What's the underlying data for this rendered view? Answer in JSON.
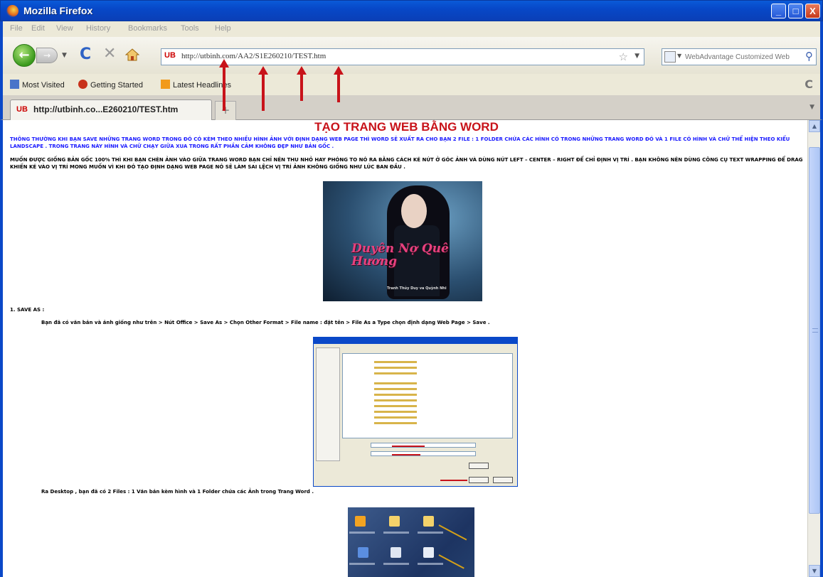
{
  "window": {
    "title": "Mozilla Firefox",
    "buttons": {
      "minimize": "_",
      "maximize": "□",
      "close": "X"
    }
  },
  "menu": [
    "File",
    "Edit",
    "View",
    "History",
    "Bookmarks",
    "Tools",
    "Help"
  ],
  "nav": {
    "back_glyph": "←",
    "forward_glyph": "→",
    "url_badge": "UB",
    "url": "http://utbinh.com/AA2/S1E260210/TEST.htm",
    "search_placeholder": "WebAdvantage Customized Web"
  },
  "bookmarks": [
    {
      "label": "Most Visited",
      "icon": "most-visited-icon",
      "color": "#4a74c9"
    },
    {
      "label": "Getting Started",
      "icon": "firefox-icon",
      "color": "#c8321b"
    },
    {
      "label": "Latest Headlines",
      "icon": "rss-icon",
      "color": "#f29a1a"
    }
  ],
  "tab": {
    "badge": "UB",
    "title": "http://utbinh.co...E260210/TEST.htm",
    "new_tab": "+"
  },
  "page": {
    "title": "TẠO TRANG WEB BẰNG WORD",
    "intro": "THÔNG THƯỜNG KHI BẠN SAVE NHỮNG TRANG WORD TRONG ĐÓ CÓ KÈM THEO NHIỀU HÌNH ẢNH VỚI ĐỊNH DẠNG WEB PAGE THÌ WORD SẼ XUẤT RA CHO BẠN 2 FILE : 1 FOLDER CHỨA CÁC HÌNH CÓ TRONG NHỮNG TRANG WORD ĐÓ VÀ 1 FILE CÓ HÌNH VÀ CHỮ THỂ HIỆN THEO KIỂU LANDSCAPE . TRONG TRANG NÀY HÌNH VÀ CHỮ CHẠY GIỮA XUA TRONG RẤT PHẦN CẢM KHÔNG ĐẸP NHƯ BẢN GỐC .",
    "para2": "MUỐN ĐƯỢC GIỐNG BẢN GỐC 100% THÌ KHI BẠN CHÈN ẢNH VÀO GIỮA TRANG WORD BẠN CHỈ NÊN THU NHỎ HAY PHÓNG TO NÓ RA BẰNG CÁCH KÉ NÚT Ở GÓC ẢNH VÀ DÙNG NÚT LEFT – CENTER – RIGHT ĐỂ CHỈ ĐỊNH VỊ TRÍ . BẠN KHÔNG NÊN DÙNG CÔNG CỤ TEXT WRAPPING ĐỂ DRAG KHIẾN KÉ VÀO VỊ TRÍ MONG MUỐN VÌ KHI ĐÓ TẠO ĐỊNH DẠNG WEB PAGE NÓ SẼ LÀM SAI LỆCH VỊ TRÍ ẢNH KHÔNG GIỐNG NHƯ LÚC BAN ĐẦU .",
    "hero_script": "Duyên Nợ Quê Hương",
    "hero_caption": "Tranh Thủy Duy va Quỳnh Nhi",
    "step1_head": "1. SAVE AS :",
    "step1_text": "Bạn đã có văn bản và ảnh giống như trên > Nút Office > Save As > Chọn Other Format > File name : đặt tên > File As a Type chọn định dạng Web Page > Save .",
    "desktop_text": "Ra Desktop , bạn đã có 2 Files : 1 Văn bản kèm hình và 1 Folder chứa các Ảnh trong Trang Word ."
  },
  "colors": {
    "title_red": "#c8131a",
    "intro_blue": "#1a1aff",
    "titlebar": "#0a48c8",
    "annotation_arrow": "#c8131a"
  }
}
